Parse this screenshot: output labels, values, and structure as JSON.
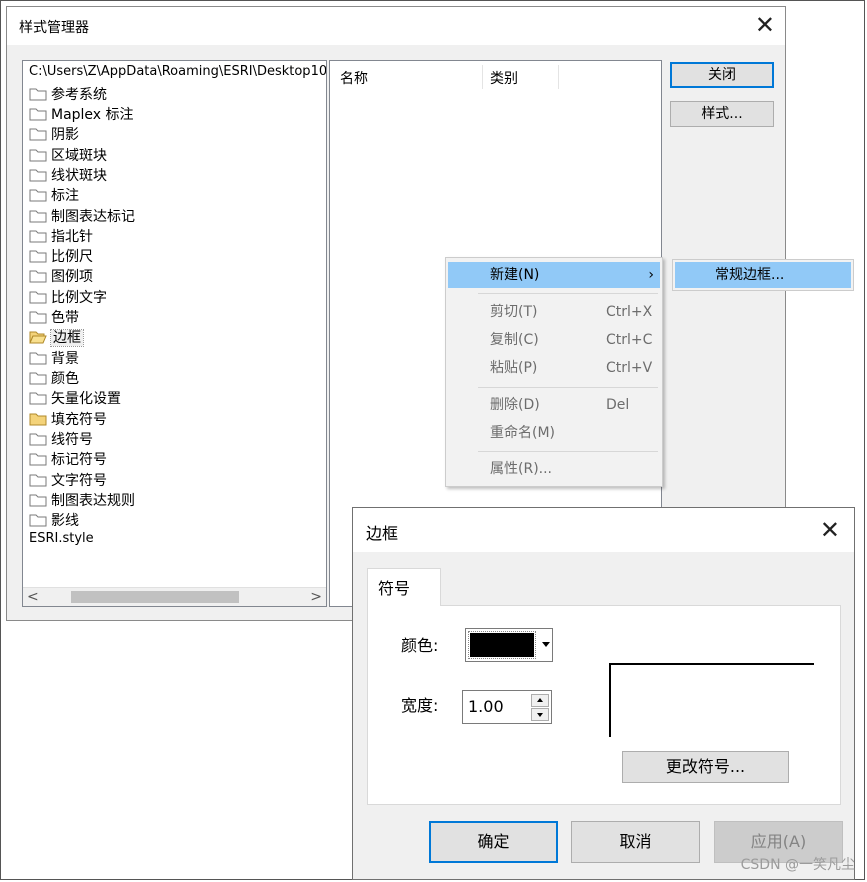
{
  "style_manager": {
    "title": "样式管理器",
    "tree": {
      "path": "C:\\Users\\Z\\AppData\\Roaming\\ESRI\\Desktop10",
      "items": [
        {
          "label": "参考系统",
          "icon": "folder-icon"
        },
        {
          "label": "Maplex 标注",
          "icon": "folder-icon"
        },
        {
          "label": "阴影",
          "icon": "folder-icon"
        },
        {
          "label": "区域斑块",
          "icon": "folder-icon"
        },
        {
          "label": "线状斑块",
          "icon": "folder-icon"
        },
        {
          "label": "标注",
          "icon": "folder-icon"
        },
        {
          "label": "制图表达标记",
          "icon": "folder-icon"
        },
        {
          "label": "指北针",
          "icon": "folder-icon"
        },
        {
          "label": "比例尺",
          "icon": "folder-icon"
        },
        {
          "label": "图例项",
          "icon": "folder-icon"
        },
        {
          "label": "比例文字",
          "icon": "folder-icon"
        },
        {
          "label": "色带",
          "icon": "folder-icon"
        },
        {
          "label": "边框",
          "icon": "folder-open-icon",
          "selected": true
        },
        {
          "label": "背景",
          "icon": "folder-icon"
        },
        {
          "label": "颜色",
          "icon": "folder-icon"
        },
        {
          "label": "矢量化设置",
          "icon": "folder-icon"
        },
        {
          "label": "填充符号",
          "icon": "folder-filled-icon"
        },
        {
          "label": "线符号",
          "icon": "folder-icon"
        },
        {
          "label": "标记符号",
          "icon": "folder-icon"
        },
        {
          "label": "文字符号",
          "icon": "folder-icon"
        },
        {
          "label": "制图表达规则",
          "icon": "folder-icon"
        },
        {
          "label": "影线",
          "icon": "folder-icon"
        }
      ],
      "style_file": "ESRI.style",
      "scroll_left": "<",
      "scroll_right": ">"
    },
    "list": {
      "columns": [
        "名称",
        "类别"
      ]
    },
    "buttons": {
      "close": "关闭",
      "styles": "样式..."
    }
  },
  "context_menu": {
    "items": [
      {
        "label": "新建(N)",
        "shortcut": "",
        "submenu": true
      },
      {
        "label": "剪切(T)",
        "shortcut": "Ctrl+X"
      },
      {
        "label": "复制(C)",
        "shortcut": "Ctrl+C"
      },
      {
        "label": "粘贴(P)",
        "shortcut": "Ctrl+V"
      },
      {
        "label": "删除(D)",
        "shortcut": "Del"
      },
      {
        "label": "重命名(M)",
        "shortcut": ""
      },
      {
        "label": "属性(R)...",
        "shortcut": ""
      }
    ],
    "submenu_arrow": "›",
    "submenu": {
      "item": "常规边框..."
    }
  },
  "border_dialog": {
    "title": "边框",
    "tab": "符号",
    "color_label": "颜色:",
    "color_value": "#000000",
    "width_label": "宽度:",
    "width_value": "1.00",
    "change_symbol": "更改符号...",
    "buttons": {
      "ok": "确定",
      "cancel": "取消",
      "apply": "应用(A)"
    }
  },
  "watermark": "CSDN @一笑凡尘"
}
